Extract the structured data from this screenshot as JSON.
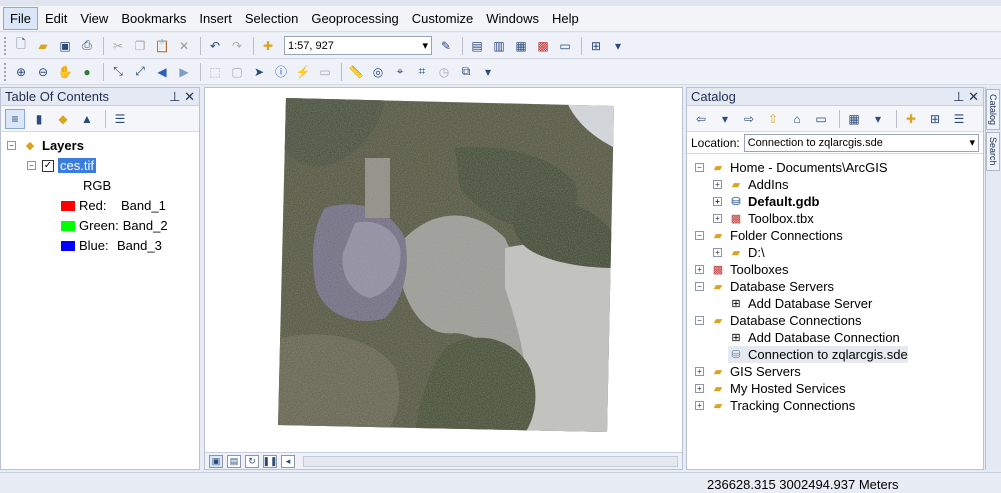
{
  "menubar": {
    "items": [
      "File",
      "Edit",
      "View",
      "Bookmarks",
      "Insert",
      "Selection",
      "Geoprocessing",
      "Customize",
      "Windows",
      "Help"
    ]
  },
  "toolbar": {
    "scale": "1:57, 927"
  },
  "toc": {
    "title": "Table Of Contents",
    "layers_label": "Layers",
    "layer_name": "ces.tif",
    "rgb_label": "RGB",
    "bands": [
      {
        "label": "Red:",
        "band": "Band_1",
        "color": "#ff0000"
      },
      {
        "label": "Green:",
        "band": "Band_2",
        "color": "#00ff00"
      },
      {
        "label": "Blue:",
        "band": "Band_3",
        "color": "#0000ff"
      }
    ]
  },
  "catalog": {
    "title": "Catalog",
    "location_label": "Location:",
    "location_value": "Connection to zqlarcgis.sde",
    "tree": [
      {
        "label": "Home - Documents\\ArcGIS",
        "exp": "−"
      },
      {
        "label": "AddIns",
        "exp": "+"
      },
      {
        "label": "Default.gdb",
        "exp": "+"
      },
      {
        "label": "Toolbox.tbx",
        "exp": "+"
      },
      {
        "label": "Folder Connections",
        "exp": "−"
      },
      {
        "label": "D:\\",
        "exp": "+"
      },
      {
        "label": "Toolboxes",
        "exp": "+"
      },
      {
        "label": "Database Servers",
        "exp": "−"
      },
      {
        "label": "Add Database Server",
        "exp": ""
      },
      {
        "label": "Database Connections",
        "exp": "−"
      },
      {
        "label": "Add Database Connection",
        "exp": ""
      },
      {
        "label": "Connection to zqlarcgis.sde",
        "exp": ""
      },
      {
        "label": "GIS Servers",
        "exp": "+"
      },
      {
        "label": "My Hosted Services",
        "exp": "+"
      },
      {
        "label": "Tracking Connections",
        "exp": "+"
      }
    ]
  },
  "side_tabs": [
    "Catalog",
    "Search"
  ],
  "status": {
    "coordinates": "236628.315  3002494.937 Meters"
  }
}
